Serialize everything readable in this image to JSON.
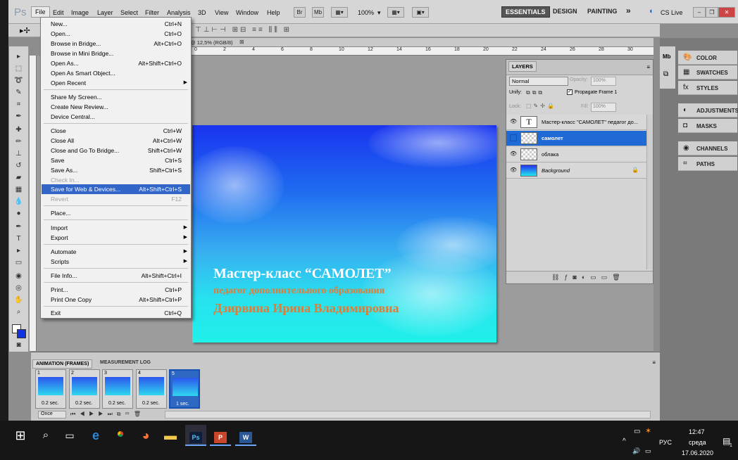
{
  "app": {
    "logo": "Ps"
  },
  "menubar": {
    "items": [
      "File",
      "Edit",
      "Image",
      "Layer",
      "Select",
      "Filter",
      "Analysis",
      "3D",
      "View",
      "Window",
      "Help"
    ],
    "bridge_btn": "Br",
    "minibridge_btn": "Mb",
    "zoom": "100%",
    "workspaces": [
      "ESSENTIALS",
      "DESIGN",
      "PAINTING"
    ],
    "more_workspaces": "»",
    "cslive": "CS Live"
  },
  "doc": {
    "tab_title": "@ 12,5% (RGB/8)",
    "ruler_ticks": [
      "0",
      "2",
      "4",
      "6",
      "8",
      "10",
      "12",
      "14",
      "16",
      "18",
      "20",
      "22",
      "24",
      "26",
      "28",
      "30"
    ]
  },
  "canvas": {
    "line1": "Мастер-класс “САМОЛЕТ”",
    "line2": "педагог дополнительного образования",
    "line3": "Дзирвина Ирина Владимировна",
    "text_white": "#ffffff",
    "text_orange": "#e57b33"
  },
  "file_menu": {
    "items": [
      {
        "label": "New...",
        "shortcut": "Ctrl+N"
      },
      {
        "label": "Open...",
        "shortcut": "Ctrl+O"
      },
      {
        "label": "Browse in Bridge...",
        "shortcut": "Alt+Ctrl+O"
      },
      {
        "label": "Browse in Mini Bridge...",
        "shortcut": ""
      },
      {
        "label": "Open As...",
        "shortcut": "Alt+Shift+Ctrl+O"
      },
      {
        "label": "Open As Smart Object...",
        "shortcut": ""
      },
      {
        "label": "Open Recent",
        "shortcut": "",
        "submenu": true
      },
      {
        "sep": true
      },
      {
        "label": "Share My Screen...",
        "shortcut": ""
      },
      {
        "label": "Create New Review...",
        "shortcut": ""
      },
      {
        "label": "Device Central...",
        "shortcut": ""
      },
      {
        "sep": true
      },
      {
        "label": "Close",
        "shortcut": "Ctrl+W"
      },
      {
        "label": "Close All",
        "shortcut": "Alt+Ctrl+W"
      },
      {
        "label": "Close and Go To Bridge...",
        "shortcut": "Shift+Ctrl+W"
      },
      {
        "label": "Save",
        "shortcut": "Ctrl+S"
      },
      {
        "label": "Save As...",
        "shortcut": "Shift+Ctrl+S"
      },
      {
        "label": "Check In...",
        "shortcut": "",
        "disabled": true
      },
      {
        "label": "Save for Web & Devices...",
        "shortcut": "Alt+Shift+Ctrl+S",
        "highlighted": true
      },
      {
        "label": "Revert",
        "shortcut": "F12",
        "disabled": true
      },
      {
        "sep": true
      },
      {
        "label": "Place...",
        "shortcut": ""
      },
      {
        "sep": true
      },
      {
        "label": "Import",
        "shortcut": "",
        "submenu": true
      },
      {
        "label": "Export",
        "shortcut": "",
        "submenu": true
      },
      {
        "sep": true
      },
      {
        "label": "Automate",
        "shortcut": "",
        "submenu": true
      },
      {
        "label": "Scripts",
        "shortcut": "",
        "submenu": true
      },
      {
        "sep": true
      },
      {
        "label": "File Info...",
        "shortcut": "Alt+Shift+Ctrl+I"
      },
      {
        "sep": true
      },
      {
        "label": "Print...",
        "shortcut": "Ctrl+P"
      },
      {
        "label": "Print One Copy",
        "shortcut": "Alt+Shift+Ctrl+P"
      },
      {
        "sep": true
      },
      {
        "label": "Exit",
        "shortcut": "Ctrl+Q"
      }
    ]
  },
  "layers_panel": {
    "title": "LAYERS",
    "blend_mode": "Normal",
    "opacity_label": "Opacity:",
    "opacity": "100%",
    "unify_label": "Unify:",
    "propagate": "Propagate Frame 1",
    "lock_label": "Lock:",
    "fill_label": "Fill:",
    "fill": "100%",
    "layers": [
      {
        "name": "Мастер-класс \"САМОЛЕТ\" педагог до...",
        "type": "text",
        "thumb_letter": "T"
      },
      {
        "name": "самолет",
        "type": "transparent",
        "selected": true
      },
      {
        "name": "облака",
        "type": "transparent"
      },
      {
        "name": "Background",
        "type": "gradient",
        "italic": true,
        "locked": true
      }
    ]
  },
  "right_dock": {
    "group1": [
      {
        "label": "COLOR",
        "icon": "palette-icon"
      },
      {
        "label": "SWATCHES",
        "icon": "swatches-icon"
      },
      {
        "label": "STYLES",
        "icon": "styles-icon"
      }
    ],
    "group2": [
      {
        "label": "ADJUSTMENTS",
        "icon": "adjustments-icon"
      },
      {
        "label": "MASKS",
        "icon": "masks-icon"
      }
    ],
    "group3": [
      {
        "label": "CHANNELS",
        "icon": "channels-icon"
      },
      {
        "label": "PATHS",
        "icon": "paths-icon"
      }
    ]
  },
  "animation": {
    "tabs": [
      "ANIMATION (FRAMES)",
      "MEASUREMENT LOG"
    ],
    "frames": [
      {
        "num": "1",
        "delay": "0.2 sec."
      },
      {
        "num": "2",
        "delay": "0.2 sec."
      },
      {
        "num": "3",
        "delay": "0.2 sec."
      },
      {
        "num": "4",
        "delay": "0.2 sec."
      },
      {
        "num": "5",
        "delay": "1 sec.",
        "selected": true
      }
    ],
    "loop": "Once"
  },
  "taskbar": {
    "lang": "РУС",
    "time": "12:47",
    "day": "среда",
    "date": "17.06.2020",
    "notif_count": "1",
    "ps_label": "Ps",
    "word_label": "W",
    "ppt_label": "P"
  }
}
